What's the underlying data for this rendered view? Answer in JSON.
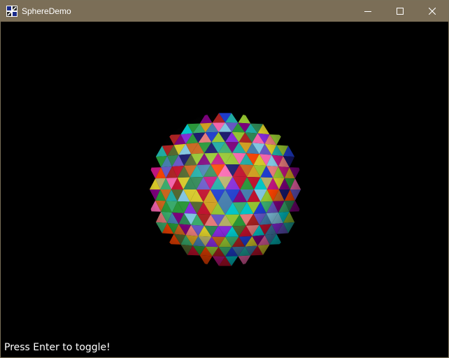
{
  "window": {
    "title": "SphereDemo",
    "icon": "app-window-icon",
    "controls": {
      "minimize_icon": "minimize-icon",
      "maximize_icon": "maximize-icon",
      "close_icon": "close-icon"
    },
    "titlebar_color": "#7b6e57"
  },
  "scene": {
    "background_color": "#000000",
    "object": "faceted sphere with multicolored triangles",
    "hint_text": "Press Enter to toggle!"
  }
}
